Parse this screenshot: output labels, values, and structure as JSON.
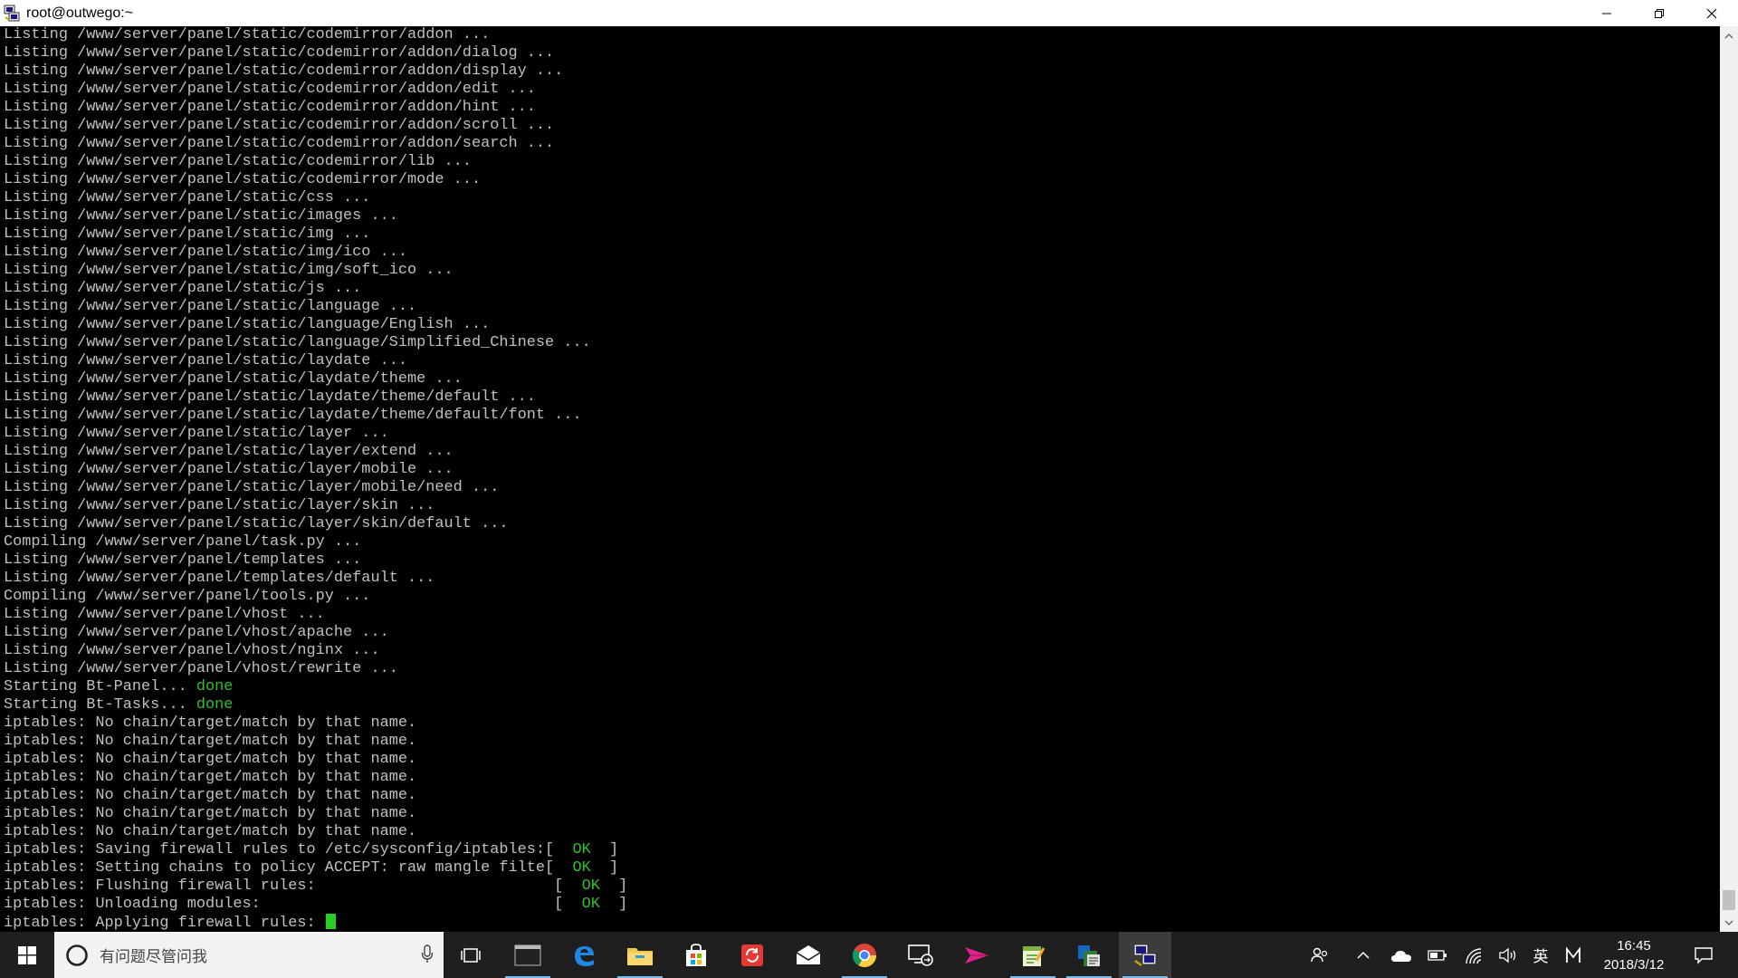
{
  "window": {
    "title": "root@outwego:~"
  },
  "terminal": {
    "lines": [
      {
        "text": "Listing /www/server/panel/static/codemirror/addon ..."
      },
      {
        "text": "Listing /www/server/panel/static/codemirror/addon/dialog ..."
      },
      {
        "text": "Listing /www/server/panel/static/codemirror/addon/display ..."
      },
      {
        "text": "Listing /www/server/panel/static/codemirror/addon/edit ..."
      },
      {
        "text": "Listing /www/server/panel/static/codemirror/addon/hint ..."
      },
      {
        "text": "Listing /www/server/panel/static/codemirror/addon/scroll ..."
      },
      {
        "text": "Listing /www/server/panel/static/codemirror/addon/search ..."
      },
      {
        "text": "Listing /www/server/panel/static/codemirror/lib ..."
      },
      {
        "text": "Listing /www/server/panel/static/codemirror/mode ..."
      },
      {
        "text": "Listing /www/server/panel/static/css ..."
      },
      {
        "text": "Listing /www/server/panel/static/images ..."
      },
      {
        "text": "Listing /www/server/panel/static/img ..."
      },
      {
        "text": "Listing /www/server/panel/static/img/ico ..."
      },
      {
        "text": "Listing /www/server/panel/static/img/soft_ico ..."
      },
      {
        "text": "Listing /www/server/panel/static/js ..."
      },
      {
        "text": "Listing /www/server/panel/static/language ..."
      },
      {
        "text": "Listing /www/server/panel/static/language/English ..."
      },
      {
        "text": "Listing /www/server/panel/static/language/Simplified_Chinese ..."
      },
      {
        "text": "Listing /www/server/panel/static/laydate ..."
      },
      {
        "text": "Listing /www/server/panel/static/laydate/theme ..."
      },
      {
        "text": "Listing /www/server/panel/static/laydate/theme/default ..."
      },
      {
        "text": "Listing /www/server/panel/static/laydate/theme/default/font ..."
      },
      {
        "text": "Listing /www/server/panel/static/layer ..."
      },
      {
        "text": "Listing /www/server/panel/static/layer/extend ..."
      },
      {
        "text": "Listing /www/server/panel/static/layer/mobile ..."
      },
      {
        "text": "Listing /www/server/panel/static/layer/mobile/need ..."
      },
      {
        "text": "Listing /www/server/panel/static/layer/skin ..."
      },
      {
        "text": "Listing /www/server/panel/static/layer/skin/default ..."
      },
      {
        "text": "Compiling /www/server/panel/task.py ..."
      },
      {
        "text": "Listing /www/server/panel/templates ..."
      },
      {
        "text": "Listing /www/server/panel/templates/default ..."
      },
      {
        "text": "Compiling /www/server/panel/tools.py ..."
      },
      {
        "text": "Listing /www/server/panel/vhost ..."
      },
      {
        "text": "Listing /www/server/panel/vhost/apache ..."
      },
      {
        "text": "Listing /www/server/panel/vhost/nginx ..."
      },
      {
        "text": "Listing /www/server/panel/vhost/rewrite ..."
      },
      {
        "text": "Starting Bt-Panel... ",
        "status": "done"
      },
      {
        "text": "Starting Bt-Tasks... ",
        "status": "done"
      },
      {
        "text": "iptables: No chain/target/match by that name."
      },
      {
        "text": "iptables: No chain/target/match by that name."
      },
      {
        "text": "iptables: No chain/target/match by that name."
      },
      {
        "text": "iptables: No chain/target/match by that name."
      },
      {
        "text": "iptables: No chain/target/match by that name."
      },
      {
        "text": "iptables: No chain/target/match by that name."
      },
      {
        "text": "iptables: No chain/target/match by that name."
      },
      {
        "text": "iptables: Saving firewall rules to /etc/sysconfig/iptables:[  ",
        "status": "OK",
        "tail": "  ]"
      },
      {
        "text": "iptables: Setting chains to policy ACCEPT: raw mangle filte[  ",
        "status": "OK",
        "tail": "  ]"
      },
      {
        "text": "iptables: Flushing firewall rules:                          [  ",
        "status": "OK",
        "tail": "  ]"
      },
      {
        "text": "iptables: Unloading modules:                                [  ",
        "status": "OK",
        "tail": "  ]"
      },
      {
        "text": "iptables: Applying firewall rules: ",
        "cursor": true
      }
    ]
  },
  "taskbar": {
    "search_placeholder": "有问题尽管问我",
    "apps": [
      {
        "name": "terminal-app",
        "running": true
      },
      {
        "name": "edge-browser",
        "running": false
      },
      {
        "name": "file-explorer",
        "running": true
      },
      {
        "name": "store",
        "running": false
      },
      {
        "name": "sync-app",
        "running": false
      },
      {
        "name": "mail",
        "running": false
      },
      {
        "name": "chrome",
        "running": true
      },
      {
        "name": "remote-desktop",
        "running": false
      },
      {
        "name": "send-app",
        "running": false
      },
      {
        "name": "notepad-app",
        "running": true
      },
      {
        "name": "docs-app",
        "running": true
      },
      {
        "name": "putty",
        "running": true,
        "active": true
      }
    ],
    "tray": {
      "ime": "英",
      "clock_time": "16:45",
      "clock_date": "2018/3/12"
    }
  },
  "colors": {
    "terminal_bg": "#000000",
    "terminal_fg": "#c0c0c0",
    "ok_green": "#2fbf2f",
    "cursor": "#25d025",
    "taskbar_bg": "#1f1f1f"
  }
}
